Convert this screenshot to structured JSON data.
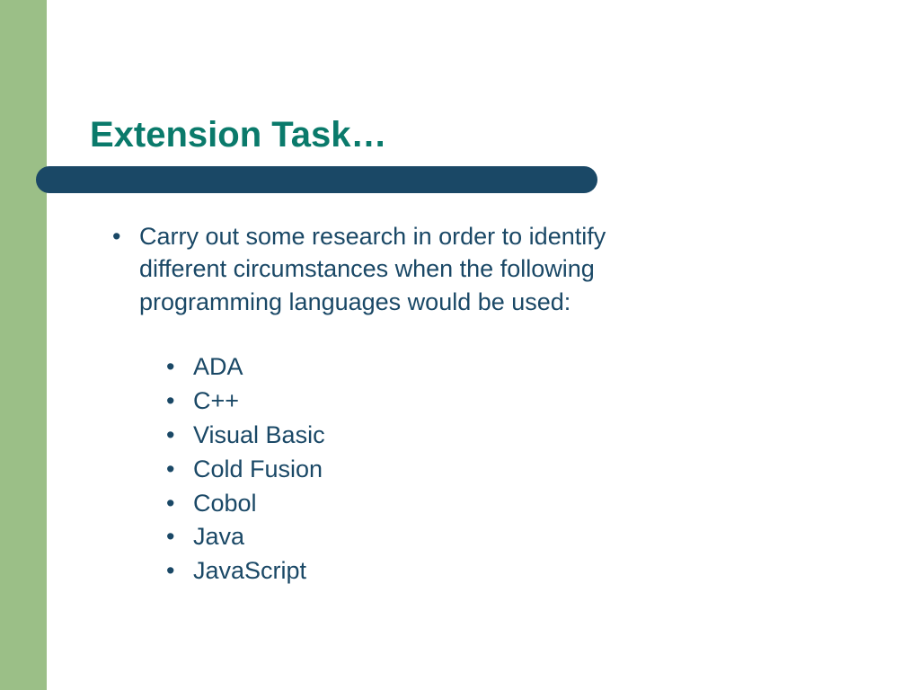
{
  "title": "Extension Task…",
  "main_bullet": "Carry out some research in order to identify different circumstances when the following programming languages would be used:",
  "sub_items": {
    "item0": "ADA",
    "item1": "C++",
    "item2": "Visual Basic",
    "item3": "Cold Fusion",
    "item4": "Cobol",
    "item5": "Java",
    "item6": "JavaScript"
  },
  "colors": {
    "green": "#9bbf87",
    "teal": "#0a7a6b",
    "navy": "#1a4866"
  }
}
